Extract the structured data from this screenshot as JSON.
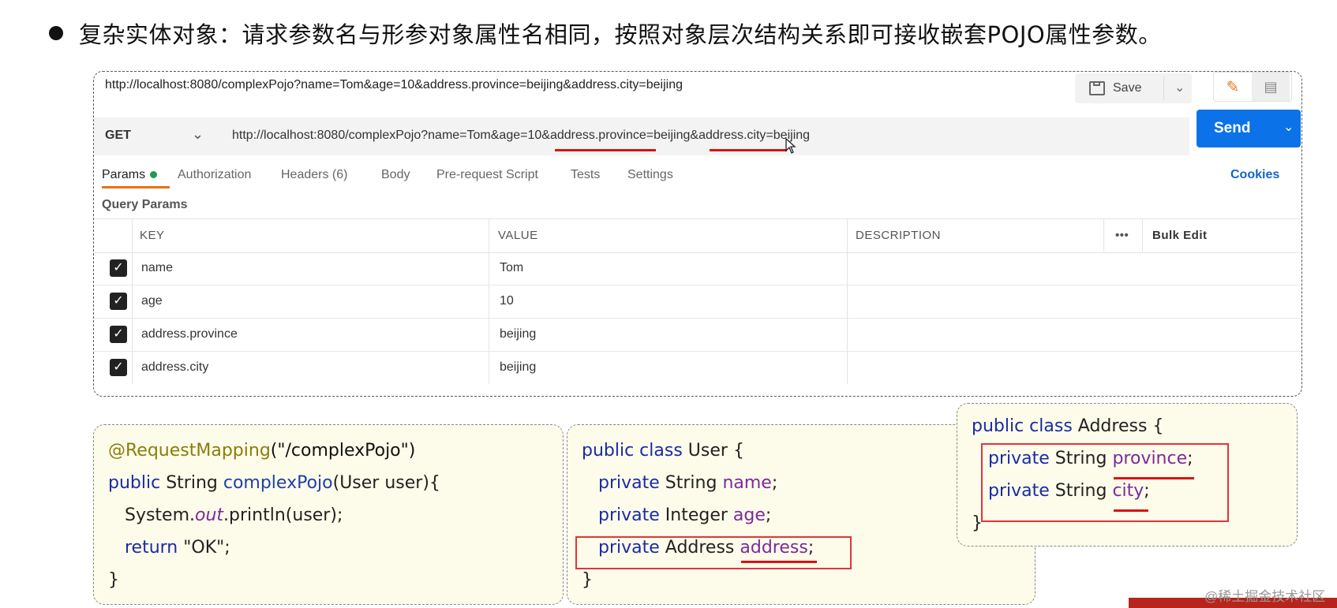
{
  "heading": "复杂实体对象：请求参数名与形参对象属性名相同，按照对象层次结构关系即可接收嵌套POJO属性参数。",
  "postman": {
    "title_url": "http://localhost:8080/complexPojo?name=Tom&age=10&address.province=beijing&address.city=beijing",
    "save_label": "Save",
    "method": "GET",
    "url_part1": "http://localhost:8080/complexPojo?name=Tom&age=10&",
    "url_part2": "address.province",
    "url_part3": "=beijing&",
    "url_part4": "address.city",
    "url_part5": "=beijing",
    "send_label": "Send",
    "tabs": {
      "params": "Params",
      "authorization": "Authorization",
      "headers": "Headers (6)",
      "body": "Body",
      "prerequest": "Pre-request Script",
      "tests": "Tests",
      "settings": "Settings"
    },
    "cookies": "Cookies",
    "query_params": "Query Params",
    "columns": {
      "key": "KEY",
      "value": "VALUE",
      "description": "DESCRIPTION",
      "more": "•••",
      "bulk_edit": "Bulk Edit"
    },
    "rows": [
      {
        "key": "name",
        "value": "Tom"
      },
      {
        "key": "age",
        "value": "10"
      },
      {
        "key": "address.province",
        "value": "beijing"
      },
      {
        "key": "address.city",
        "value": "beijing"
      }
    ],
    "check_mark": "✓"
  },
  "code_controller": {
    "annotation": "@RequestMapping",
    "ann_arg": "(\"/complexPojo\")",
    "l2_kw": "public",
    "l2_rest": " String ",
    "l2_method": "complexPojo",
    "l2_tail": "(User user){",
    "l3_a": "System.",
    "l3_b": "out",
    "l3_c": ".println(user);",
    "l4_kw": "return",
    "l4_rest": " \"OK\";",
    "l5": "}"
  },
  "code_user": {
    "l1_kw": "public class",
    "l1_rest": " User {",
    "l2_kw": "private",
    "l2_type": " String ",
    "l2_field": "name",
    "l3_kw": "private",
    "l3_type": " Integer ",
    "l3_field": "age",
    "l4_kw": "private",
    "l4_type": " Address ",
    "l4_field": "address",
    "semi": ";",
    "l5": "}"
  },
  "code_address": {
    "l1_kw": "public class",
    "l1_rest": " Address {",
    "l2_kw": "private",
    "l2_type": " String ",
    "l2_field": "province",
    "l3_kw": "private",
    "l3_type": " String ",
    "l3_field": "city",
    "semi": ";",
    "l4": "}"
  },
  "watermark": "@稀土掘金技术社区"
}
